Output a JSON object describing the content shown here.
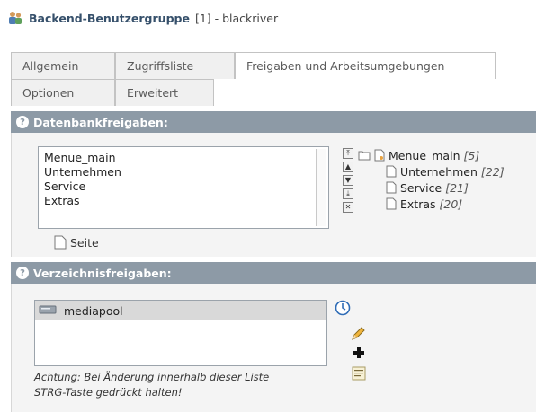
{
  "header": {
    "title": "Backend-Benutzergruppe",
    "suffix": "[1] - blackriver"
  },
  "tabs_row1": [
    "Allgemein",
    "Zugriffsliste",
    "Freigaben und Arbeitsumgebungen"
  ],
  "tabs_row2": [
    "Optionen",
    "Erweitert"
  ],
  "active_tab": "Freigaben und Arbeitsumgebungen",
  "sections": {
    "db": {
      "label": "Datenbankfreigaben:"
    },
    "fs": {
      "label": "Verzeichnisfreigaben:"
    }
  },
  "db_selected": [
    "Menue_main",
    "Unternehmen",
    "Service",
    "Extras"
  ],
  "db_tree": [
    {
      "label": "Menue_main",
      "count": "[5]"
    },
    {
      "label": "Unternehmen",
      "count": "[22]"
    },
    {
      "label": "Service",
      "count": "[21]"
    },
    {
      "label": "Extras",
      "count": "[20]"
    }
  ],
  "seite_label": "Seite",
  "fs_selected": [
    "mediapool"
  ],
  "note": {
    "line1": "Achtung: Bei Änderung innerhalb dieser Liste",
    "line2": "STRG-Taste gedrückt halten!"
  },
  "colors": {
    "section_header_bg": "#8d9aa6",
    "title_blue": "#36506b"
  },
  "icons": {
    "group": "group-icon",
    "help": "help-icon",
    "folder": "folder-icon",
    "page": "page-icon",
    "edit": "pencil-icon",
    "add": "plus-icon",
    "browse": "element-browser-icon",
    "clock": "clock-icon"
  }
}
